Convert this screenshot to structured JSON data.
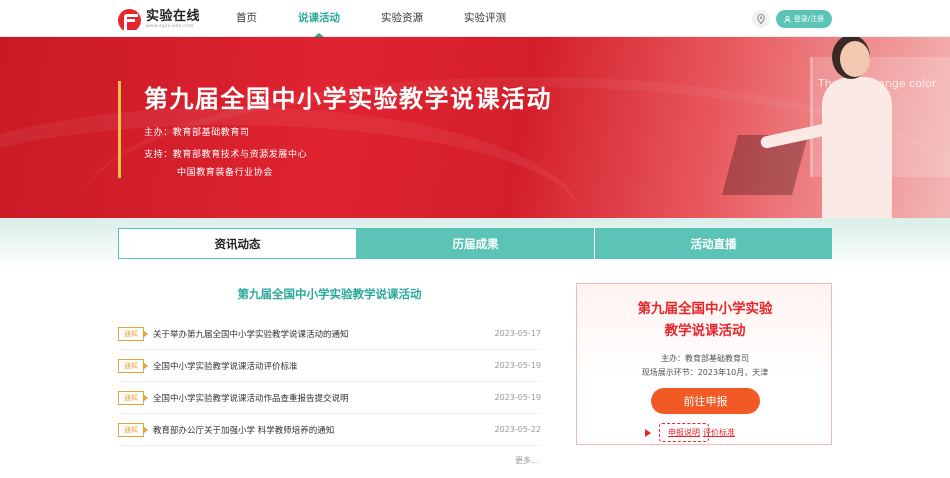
{
  "header": {
    "logo_title": "实验在线",
    "logo_sub": "www.syzx-kda.com",
    "nav": [
      {
        "label": "首页"
      },
      {
        "label": "说课活动"
      },
      {
        "label": "实验资源"
      },
      {
        "label": "实验评测"
      }
    ],
    "active_nav": "说课活动",
    "login_label": "登录/注册",
    "location_icon": "map-pin-icon",
    "user_icon": "user-icon"
  },
  "banner": {
    "title": "第九届全国中小学实验教学说课活动",
    "host": "主办：教育部基础教育司",
    "support_1": "支持：教育部教育技术与资源发展中心",
    "support_2": "中国教育装备行业协会",
    "board_text": "The ... s change color"
  },
  "tabs": [
    {
      "label": "资讯动态"
    },
    {
      "label": "历届成果"
    },
    {
      "label": "活动直播"
    }
  ],
  "news": {
    "heading": "第九届全国中小学实验教学说课活动",
    "tag": "通知",
    "items": [
      {
        "tag": "通知",
        "title": "关于举办第九届全国中小学实验教学说课活动的通知",
        "date": "2023-05-17"
      },
      {
        "tag": "通知",
        "title": "全国中小学实验教学说课活动评价标准",
        "date": "2023-05-19"
      },
      {
        "tag": "通知",
        "title": "全国中小学实验教学说课活动作品查重报告提交说明",
        "date": "2023-05-19"
      },
      {
        "tag": "通知",
        "title": "教育部办公厅关于加强小学 科学教师培养的通知",
        "date": "2023-05-22"
      }
    ],
    "more": "更多..."
  },
  "card": {
    "title_1": "第九届全国中小学实验",
    "title_2": "教学说课活动",
    "host": "主办：教育部基础教育司",
    "venue": "现场展示环节：2023年10月，天津",
    "apply_label": "前往申报",
    "link_1": "申报说明",
    "link_2": "评价标准"
  },
  "colors": {
    "accent_teal": "#5cc4b6",
    "brand_red": "#e8252a",
    "apply_orange": "#f15a24",
    "tag_orange": "#e6a23c"
  }
}
